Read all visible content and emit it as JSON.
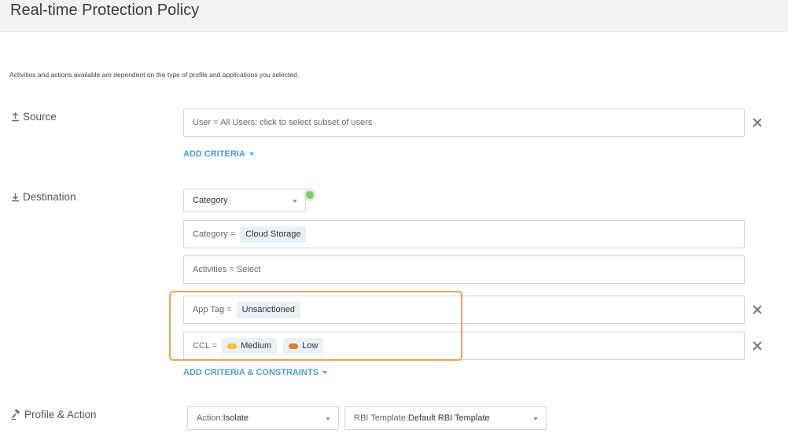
{
  "header": {
    "title": "Real-time Protection Policy"
  },
  "note": "Activities and actions available are dependent on the type of profile and applications you selected.",
  "source": {
    "label": "Source",
    "field": "User = All Users: click to select subset of users",
    "add_criteria": "ADD CRITERIA"
  },
  "destination": {
    "label": "Destination",
    "type_select": "Category",
    "category": {
      "label": "Category =",
      "chips": [
        "Cloud Storage"
      ]
    },
    "activities": "Activities = Select",
    "app_tag": {
      "label": "App Tag =",
      "chips": [
        "Unsanctioned"
      ]
    },
    "ccl": {
      "label": "CCL =",
      "chips": [
        {
          "text": "Medium",
          "color": "#f3c43a"
        },
        {
          "text": "Low",
          "color": "#ea7a2e"
        }
      ]
    },
    "add_criteria": "ADD CRITERIA & CONSTRAINTS"
  },
  "profile_action": {
    "label": "Profile & Action",
    "action": {
      "key": "Action: ",
      "value": "Isolate"
    },
    "rbi": {
      "key": "RBI Template: ",
      "value": "Default RBI Template"
    }
  },
  "colors": {
    "accent": "#4a9fd0",
    "highlight": "#f5a04f",
    "status_dot": "#7ccd72"
  }
}
